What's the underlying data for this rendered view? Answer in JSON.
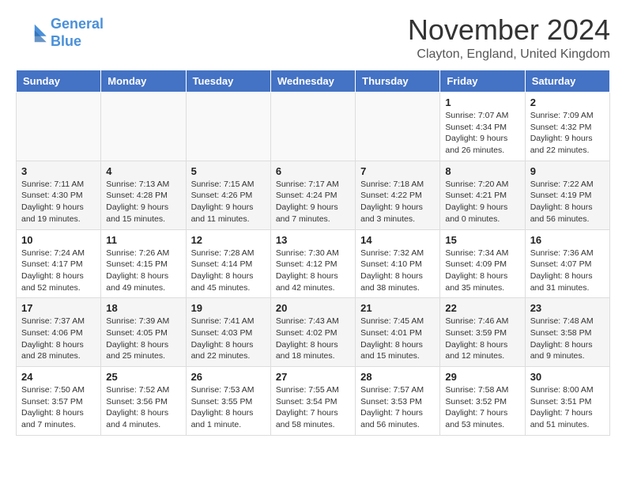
{
  "logo": {
    "line1": "General",
    "line2": "Blue"
  },
  "title": "November 2024",
  "location": "Clayton, England, United Kingdom",
  "weekdays": [
    "Sunday",
    "Monday",
    "Tuesday",
    "Wednesday",
    "Thursday",
    "Friday",
    "Saturday"
  ],
  "weeks": [
    [
      {
        "day": "",
        "info": ""
      },
      {
        "day": "",
        "info": ""
      },
      {
        "day": "",
        "info": ""
      },
      {
        "day": "",
        "info": ""
      },
      {
        "day": "",
        "info": ""
      },
      {
        "day": "1",
        "info": "Sunrise: 7:07 AM\nSunset: 4:34 PM\nDaylight: 9 hours and 26 minutes."
      },
      {
        "day": "2",
        "info": "Sunrise: 7:09 AM\nSunset: 4:32 PM\nDaylight: 9 hours and 22 minutes."
      }
    ],
    [
      {
        "day": "3",
        "info": "Sunrise: 7:11 AM\nSunset: 4:30 PM\nDaylight: 9 hours and 19 minutes."
      },
      {
        "day": "4",
        "info": "Sunrise: 7:13 AM\nSunset: 4:28 PM\nDaylight: 9 hours and 15 minutes."
      },
      {
        "day": "5",
        "info": "Sunrise: 7:15 AM\nSunset: 4:26 PM\nDaylight: 9 hours and 11 minutes."
      },
      {
        "day": "6",
        "info": "Sunrise: 7:17 AM\nSunset: 4:24 PM\nDaylight: 9 hours and 7 minutes."
      },
      {
        "day": "7",
        "info": "Sunrise: 7:18 AM\nSunset: 4:22 PM\nDaylight: 9 hours and 3 minutes."
      },
      {
        "day": "8",
        "info": "Sunrise: 7:20 AM\nSunset: 4:21 PM\nDaylight: 9 hours and 0 minutes."
      },
      {
        "day": "9",
        "info": "Sunrise: 7:22 AM\nSunset: 4:19 PM\nDaylight: 8 hours and 56 minutes."
      }
    ],
    [
      {
        "day": "10",
        "info": "Sunrise: 7:24 AM\nSunset: 4:17 PM\nDaylight: 8 hours and 52 minutes."
      },
      {
        "day": "11",
        "info": "Sunrise: 7:26 AM\nSunset: 4:15 PM\nDaylight: 8 hours and 49 minutes."
      },
      {
        "day": "12",
        "info": "Sunrise: 7:28 AM\nSunset: 4:14 PM\nDaylight: 8 hours and 45 minutes."
      },
      {
        "day": "13",
        "info": "Sunrise: 7:30 AM\nSunset: 4:12 PM\nDaylight: 8 hours and 42 minutes."
      },
      {
        "day": "14",
        "info": "Sunrise: 7:32 AM\nSunset: 4:10 PM\nDaylight: 8 hours and 38 minutes."
      },
      {
        "day": "15",
        "info": "Sunrise: 7:34 AM\nSunset: 4:09 PM\nDaylight: 8 hours and 35 minutes."
      },
      {
        "day": "16",
        "info": "Sunrise: 7:36 AM\nSunset: 4:07 PM\nDaylight: 8 hours and 31 minutes."
      }
    ],
    [
      {
        "day": "17",
        "info": "Sunrise: 7:37 AM\nSunset: 4:06 PM\nDaylight: 8 hours and 28 minutes."
      },
      {
        "day": "18",
        "info": "Sunrise: 7:39 AM\nSunset: 4:05 PM\nDaylight: 8 hours and 25 minutes."
      },
      {
        "day": "19",
        "info": "Sunrise: 7:41 AM\nSunset: 4:03 PM\nDaylight: 8 hours and 22 minutes."
      },
      {
        "day": "20",
        "info": "Sunrise: 7:43 AM\nSunset: 4:02 PM\nDaylight: 8 hours and 18 minutes."
      },
      {
        "day": "21",
        "info": "Sunrise: 7:45 AM\nSunset: 4:01 PM\nDaylight: 8 hours and 15 minutes."
      },
      {
        "day": "22",
        "info": "Sunrise: 7:46 AM\nSunset: 3:59 PM\nDaylight: 8 hours and 12 minutes."
      },
      {
        "day": "23",
        "info": "Sunrise: 7:48 AM\nSunset: 3:58 PM\nDaylight: 8 hours and 9 minutes."
      }
    ],
    [
      {
        "day": "24",
        "info": "Sunrise: 7:50 AM\nSunset: 3:57 PM\nDaylight: 8 hours and 7 minutes."
      },
      {
        "day": "25",
        "info": "Sunrise: 7:52 AM\nSunset: 3:56 PM\nDaylight: 8 hours and 4 minutes."
      },
      {
        "day": "26",
        "info": "Sunrise: 7:53 AM\nSunset: 3:55 PM\nDaylight: 8 hours and 1 minute."
      },
      {
        "day": "27",
        "info": "Sunrise: 7:55 AM\nSunset: 3:54 PM\nDaylight: 7 hours and 58 minutes."
      },
      {
        "day": "28",
        "info": "Sunrise: 7:57 AM\nSunset: 3:53 PM\nDaylight: 7 hours and 56 minutes."
      },
      {
        "day": "29",
        "info": "Sunrise: 7:58 AM\nSunset: 3:52 PM\nDaylight: 7 hours and 53 minutes."
      },
      {
        "day": "30",
        "info": "Sunrise: 8:00 AM\nSunset: 3:51 PM\nDaylight: 7 hours and 51 minutes."
      }
    ]
  ]
}
